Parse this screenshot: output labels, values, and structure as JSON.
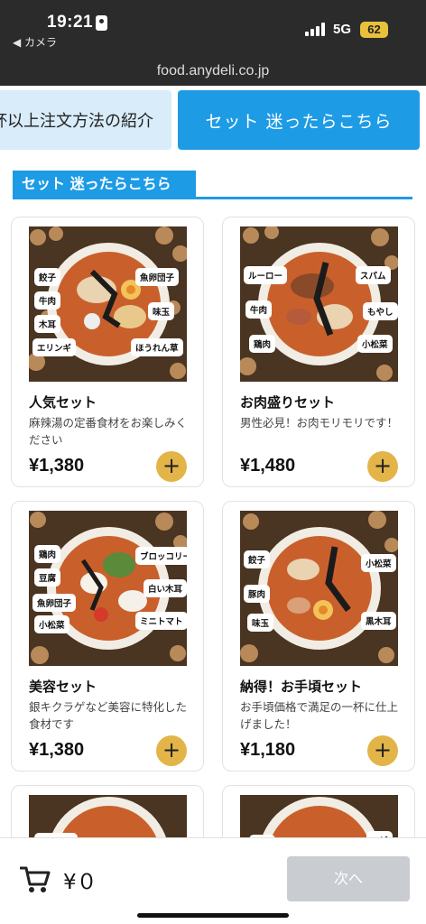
{
  "status": {
    "time": "19:21",
    "back": "◀ カメラ",
    "network": "5G",
    "battery": "62"
  },
  "browser": {
    "url": "food.anydeli.co.jp"
  },
  "tabs": [
    {
      "label": "杯以上注文方法の紹介"
    },
    {
      "label": "セット 迷ったらこちら"
    }
  ],
  "section": {
    "title": "セット 迷ったらこちら"
  },
  "colors": {
    "accent": "#1e9be5",
    "add_button": "#e3b448",
    "next_disabled": "#c9ccd0"
  },
  "products": [
    {
      "name": "人気セット",
      "desc": "麻辣湯の定番食材をお楽しみください",
      "price": "¥1,380",
      "add": "+",
      "tags": [
        "餃子",
        "魚卵団子",
        "牛肉",
        "味玉",
        "木耳",
        "エリンギ",
        "ほうれん草"
      ]
    },
    {
      "name": "お肉盛りセット",
      "desc": "男性必見！お肉モリモリです！",
      "price": "¥1,480",
      "add": "+",
      "tags": [
        "ルーロー",
        "スパム",
        "牛肉",
        "もやし",
        "鶏肉",
        "小松菜"
      ]
    },
    {
      "name": "美容セット",
      "desc": "銀キクラゲなど美容に特化した食材です",
      "price": "¥1,380",
      "add": "+",
      "tags": [
        "鶏肉",
        "ブロッコリー",
        "豆腐",
        "白い木耳",
        "魚卵団子",
        "小松菜",
        "ミニトマト"
      ]
    },
    {
      "name": "納得！お手頃セット",
      "desc": "お手頃価格で満足の一杯に仕上げました！",
      "price": "¥1,180",
      "add": "+",
      "tags": [
        "餃子",
        "小松菜",
        "豚肉",
        "味玉",
        "黒木耳"
      ]
    }
  ],
  "partial_cards": [
    {
      "tags": [
        "ルーロー"
      ]
    },
    {
      "tags": [
        "牛肉",
        "エビ"
      ]
    }
  ],
  "cart": {
    "total": "¥０",
    "icon": "cart-icon",
    "next_label": "次へ"
  }
}
